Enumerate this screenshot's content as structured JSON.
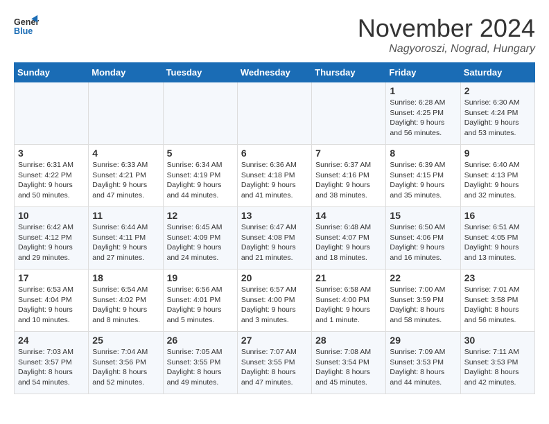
{
  "header": {
    "logo_line1": "General",
    "logo_line2": "Blue",
    "month": "November 2024",
    "location": "Nagyoroszi, Nograd, Hungary"
  },
  "weekdays": [
    "Sunday",
    "Monday",
    "Tuesday",
    "Wednesday",
    "Thursday",
    "Friday",
    "Saturday"
  ],
  "weeks": [
    [
      {
        "day": "",
        "text": ""
      },
      {
        "day": "",
        "text": ""
      },
      {
        "day": "",
        "text": ""
      },
      {
        "day": "",
        "text": ""
      },
      {
        "day": "",
        "text": ""
      },
      {
        "day": "1",
        "text": "Sunrise: 6:28 AM\nSunset: 4:25 PM\nDaylight: 9 hours and 56 minutes."
      },
      {
        "day": "2",
        "text": "Sunrise: 6:30 AM\nSunset: 4:24 PM\nDaylight: 9 hours and 53 minutes."
      }
    ],
    [
      {
        "day": "3",
        "text": "Sunrise: 6:31 AM\nSunset: 4:22 PM\nDaylight: 9 hours and 50 minutes."
      },
      {
        "day": "4",
        "text": "Sunrise: 6:33 AM\nSunset: 4:21 PM\nDaylight: 9 hours and 47 minutes."
      },
      {
        "day": "5",
        "text": "Sunrise: 6:34 AM\nSunset: 4:19 PM\nDaylight: 9 hours and 44 minutes."
      },
      {
        "day": "6",
        "text": "Sunrise: 6:36 AM\nSunset: 4:18 PM\nDaylight: 9 hours and 41 minutes."
      },
      {
        "day": "7",
        "text": "Sunrise: 6:37 AM\nSunset: 4:16 PM\nDaylight: 9 hours and 38 minutes."
      },
      {
        "day": "8",
        "text": "Sunrise: 6:39 AM\nSunset: 4:15 PM\nDaylight: 9 hours and 35 minutes."
      },
      {
        "day": "9",
        "text": "Sunrise: 6:40 AM\nSunset: 4:13 PM\nDaylight: 9 hours and 32 minutes."
      }
    ],
    [
      {
        "day": "10",
        "text": "Sunrise: 6:42 AM\nSunset: 4:12 PM\nDaylight: 9 hours and 29 minutes."
      },
      {
        "day": "11",
        "text": "Sunrise: 6:44 AM\nSunset: 4:11 PM\nDaylight: 9 hours and 27 minutes."
      },
      {
        "day": "12",
        "text": "Sunrise: 6:45 AM\nSunset: 4:09 PM\nDaylight: 9 hours and 24 minutes."
      },
      {
        "day": "13",
        "text": "Sunrise: 6:47 AM\nSunset: 4:08 PM\nDaylight: 9 hours and 21 minutes."
      },
      {
        "day": "14",
        "text": "Sunrise: 6:48 AM\nSunset: 4:07 PM\nDaylight: 9 hours and 18 minutes."
      },
      {
        "day": "15",
        "text": "Sunrise: 6:50 AM\nSunset: 4:06 PM\nDaylight: 9 hours and 16 minutes."
      },
      {
        "day": "16",
        "text": "Sunrise: 6:51 AM\nSunset: 4:05 PM\nDaylight: 9 hours and 13 minutes."
      }
    ],
    [
      {
        "day": "17",
        "text": "Sunrise: 6:53 AM\nSunset: 4:04 PM\nDaylight: 9 hours and 10 minutes."
      },
      {
        "day": "18",
        "text": "Sunrise: 6:54 AM\nSunset: 4:02 PM\nDaylight: 9 hours and 8 minutes."
      },
      {
        "day": "19",
        "text": "Sunrise: 6:56 AM\nSunset: 4:01 PM\nDaylight: 9 hours and 5 minutes."
      },
      {
        "day": "20",
        "text": "Sunrise: 6:57 AM\nSunset: 4:00 PM\nDaylight: 9 hours and 3 minutes."
      },
      {
        "day": "21",
        "text": "Sunrise: 6:58 AM\nSunset: 4:00 PM\nDaylight: 9 hours and 1 minute."
      },
      {
        "day": "22",
        "text": "Sunrise: 7:00 AM\nSunset: 3:59 PM\nDaylight: 8 hours and 58 minutes."
      },
      {
        "day": "23",
        "text": "Sunrise: 7:01 AM\nSunset: 3:58 PM\nDaylight: 8 hours and 56 minutes."
      }
    ],
    [
      {
        "day": "24",
        "text": "Sunrise: 7:03 AM\nSunset: 3:57 PM\nDaylight: 8 hours and 54 minutes."
      },
      {
        "day": "25",
        "text": "Sunrise: 7:04 AM\nSunset: 3:56 PM\nDaylight: 8 hours and 52 minutes."
      },
      {
        "day": "26",
        "text": "Sunrise: 7:05 AM\nSunset: 3:55 PM\nDaylight: 8 hours and 49 minutes."
      },
      {
        "day": "27",
        "text": "Sunrise: 7:07 AM\nSunset: 3:55 PM\nDaylight: 8 hours and 47 minutes."
      },
      {
        "day": "28",
        "text": "Sunrise: 7:08 AM\nSunset: 3:54 PM\nDaylight: 8 hours and 45 minutes."
      },
      {
        "day": "29",
        "text": "Sunrise: 7:09 AM\nSunset: 3:53 PM\nDaylight: 8 hours and 44 minutes."
      },
      {
        "day": "30",
        "text": "Sunrise: 7:11 AM\nSunset: 3:53 PM\nDaylight: 8 hours and 42 minutes."
      }
    ]
  ]
}
